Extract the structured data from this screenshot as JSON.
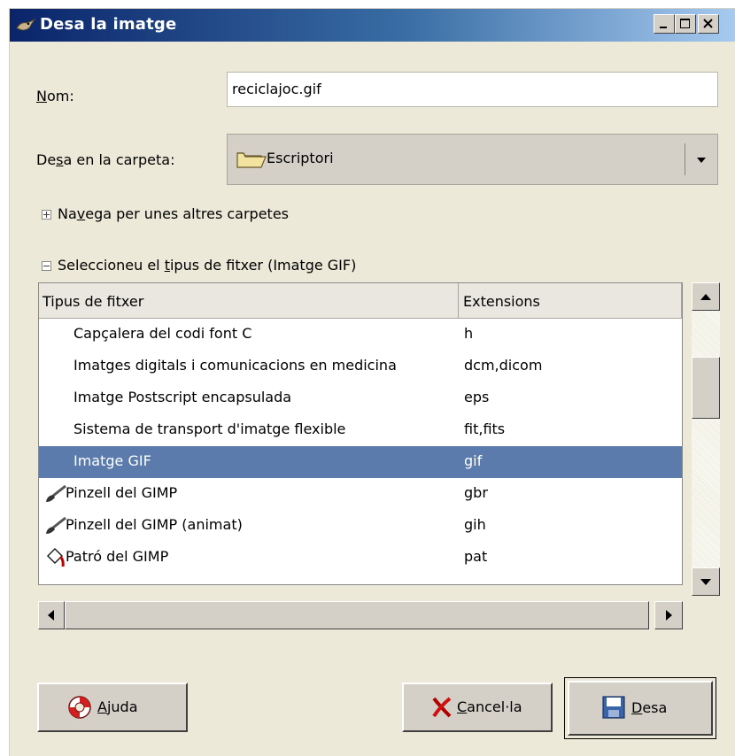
{
  "window": {
    "title": "Desa la imatge",
    "minimize_glyph": "_",
    "maximize_glyph": "□",
    "close_glyph": "×"
  },
  "name_field": {
    "label_mnemonic": "N",
    "label_rest": "om:",
    "value": "reciclajoc.gif"
  },
  "folder_combo": {
    "label_before": "De",
    "label_mnemonic": "s",
    "label_after": "a en la carpeta:",
    "value": "Escriptori",
    "icon": "folder-icon"
  },
  "browse": {
    "text_before": "Na",
    "text_mnemonic": "v",
    "text_after": "ega per unes altres carpetes",
    "state": "collapsed"
  },
  "filetype_section": {
    "text_before": "Seleccioneu el ",
    "text_mnemonic": "t",
    "text_after": "ipus de fitxer (Imatge GIF)",
    "state": "expanded"
  },
  "table": {
    "columns": [
      "Tipus de fitxer",
      "Extensions"
    ],
    "rows": [
      {
        "type": "Capçalera del codi font C",
        "ext": "h",
        "icon": ""
      },
      {
        "type": "Imatges digitals i comunicacions en medicina",
        "ext": "dcm,dicom",
        "icon": ""
      },
      {
        "type": "Imatge Postscript encapsulada",
        "ext": "eps",
        "icon": ""
      },
      {
        "type": "Sistema de transport d'imatge flexible",
        "ext": "fit,fits",
        "icon": ""
      },
      {
        "type": "Imatge GIF",
        "ext": "gif",
        "icon": "",
        "selected": true
      },
      {
        "type": "Pinzell del GIMP",
        "ext": "gbr",
        "icon": "brush-icon"
      },
      {
        "type": "Pinzell del GIMP (animat)",
        "ext": "gih",
        "icon": "brush-icon"
      },
      {
        "type": "Patró del GIMP",
        "ext": "pat",
        "icon": "bucket-icon"
      }
    ]
  },
  "buttons": {
    "help": {
      "mnemonic": "A",
      "rest": "juda",
      "icon": "lifebuoy-icon"
    },
    "cancel": {
      "mnemonic": "C",
      "rest": "ancel·la",
      "icon": "red-x-icon"
    },
    "save": {
      "mnemonic": "D",
      "rest": "esa",
      "icon": "floppy-disk-icon"
    }
  },
  "colors": {
    "title_bar": "#0a246a",
    "selection": "#5a7bab",
    "dialog_bg": "#ece9d8"
  }
}
